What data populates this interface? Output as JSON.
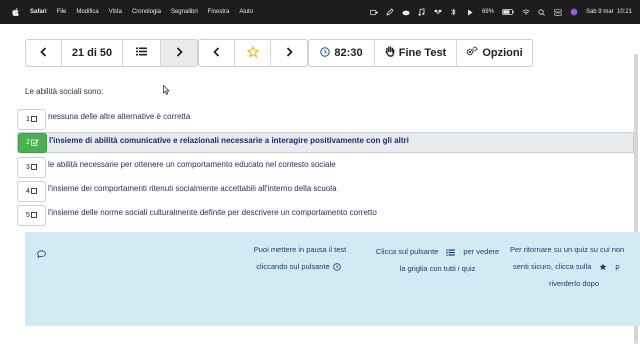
{
  "menubar": {
    "app": "Safari",
    "items": [
      "File",
      "Modifica",
      "Vista",
      "Cronologia",
      "Segnalibri",
      "Finestra",
      "Aiuto"
    ],
    "battery": "69%",
    "datetime": "Sab 9 mar  10:21"
  },
  "toolbar": {
    "counter": "21 di 50",
    "timer": "82:30",
    "finish_label": "Fine Test",
    "options_label": "Opzioni"
  },
  "question": {
    "text": "Le abilità sociali sono:"
  },
  "answers": [
    {
      "num": "1",
      "text": "nessuna delle altre alternative è corretta",
      "selected": false
    },
    {
      "num": "2",
      "text": "l'insieme di abilità comunicative e relazionali necessarie a interagire positivamente con gli altri",
      "selected": true
    },
    {
      "num": "3",
      "text": "le abilità necessarie per ottenere un comportamento educato nel contesto sociale",
      "selected": false
    },
    {
      "num": "4",
      "text": "l'insieme dei comportamenti ritenuti socialmente accettabili all'interno della scuola",
      "selected": false
    },
    {
      "num": "5",
      "text": "l'insieme delle norme sociali culturalmente definite per descrivere un comportamento corretto",
      "selected": false
    }
  ],
  "info": {
    "pause_line1": "Puoi mettere in pausa il test",
    "pause_line2": "cliccando sul pulsante",
    "grid_line1a": "Clicca sul pulsante",
    "grid_line1b": "per vedere",
    "grid_line2": "la griglia con tutti i quiz",
    "fav_line1": "Per ritornare su un quiz su cui non",
    "fav_line2a": "senti sicuro, clicca sulla",
    "fav_line2b": "p",
    "fav_line3": "riverderlo dopo"
  },
  "colors": {
    "selected_green": "#4caf50",
    "info_bg": "#d3e9f3",
    "star": "#f2b01e"
  }
}
